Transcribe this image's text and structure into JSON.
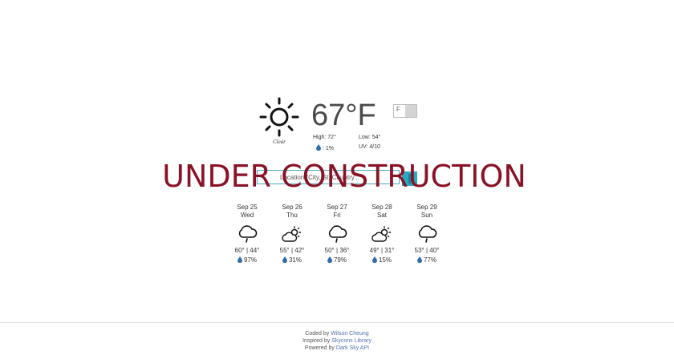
{
  "current": {
    "icon": "clear-day-sun-icon",
    "condition": "Clear",
    "temperature": "67°F",
    "unit_toggle": "F",
    "high": "High: 72°",
    "low": "Low: 54°",
    "precip": ": 1%",
    "uv": "UV: 4/10"
  },
  "search": {
    "placeholder": "Location (City, St, Country..."
  },
  "banner": "UNDER CONSTRUCTION",
  "forecast": [
    {
      "date": "Sep 25",
      "dow": "Wed",
      "icon": "cloud-drizzle-icon",
      "hilo": "60° | 44°",
      "precip": "97%"
    },
    {
      "date": "Sep 26",
      "dow": "Thu",
      "icon": "partly-cloudy-day-icon",
      "hilo": "55° | 42°",
      "precip": "31%"
    },
    {
      "date": "Sep 27",
      "dow": "Fri",
      "icon": "cloud-drizzle-icon",
      "hilo": "50° | 36°",
      "precip": "79%"
    },
    {
      "date": "Sep 28",
      "dow": "Sat",
      "icon": "partly-cloudy-day-icon",
      "hilo": "49° | 31°",
      "precip": "15%"
    },
    {
      "date": "Sep 29",
      "dow": "Sun",
      "icon": "cloud-drizzle-icon",
      "hilo": "53° | 40°",
      "precip": "77%"
    }
  ],
  "footer": {
    "coded_prefix": "Coded by ",
    "coded_link": "Wilson Cheung",
    "inspired_prefix": "Inspired by ",
    "inspired_link": "Skycons Library",
    "powered_prefix": "Powered by ",
    "powered_link": "Dark Sky API"
  },
  "colors": {
    "accent": "#2aa9c2",
    "banner": "#8a1226",
    "link": "#5470b3",
    "drop": "#2f6fa8"
  }
}
